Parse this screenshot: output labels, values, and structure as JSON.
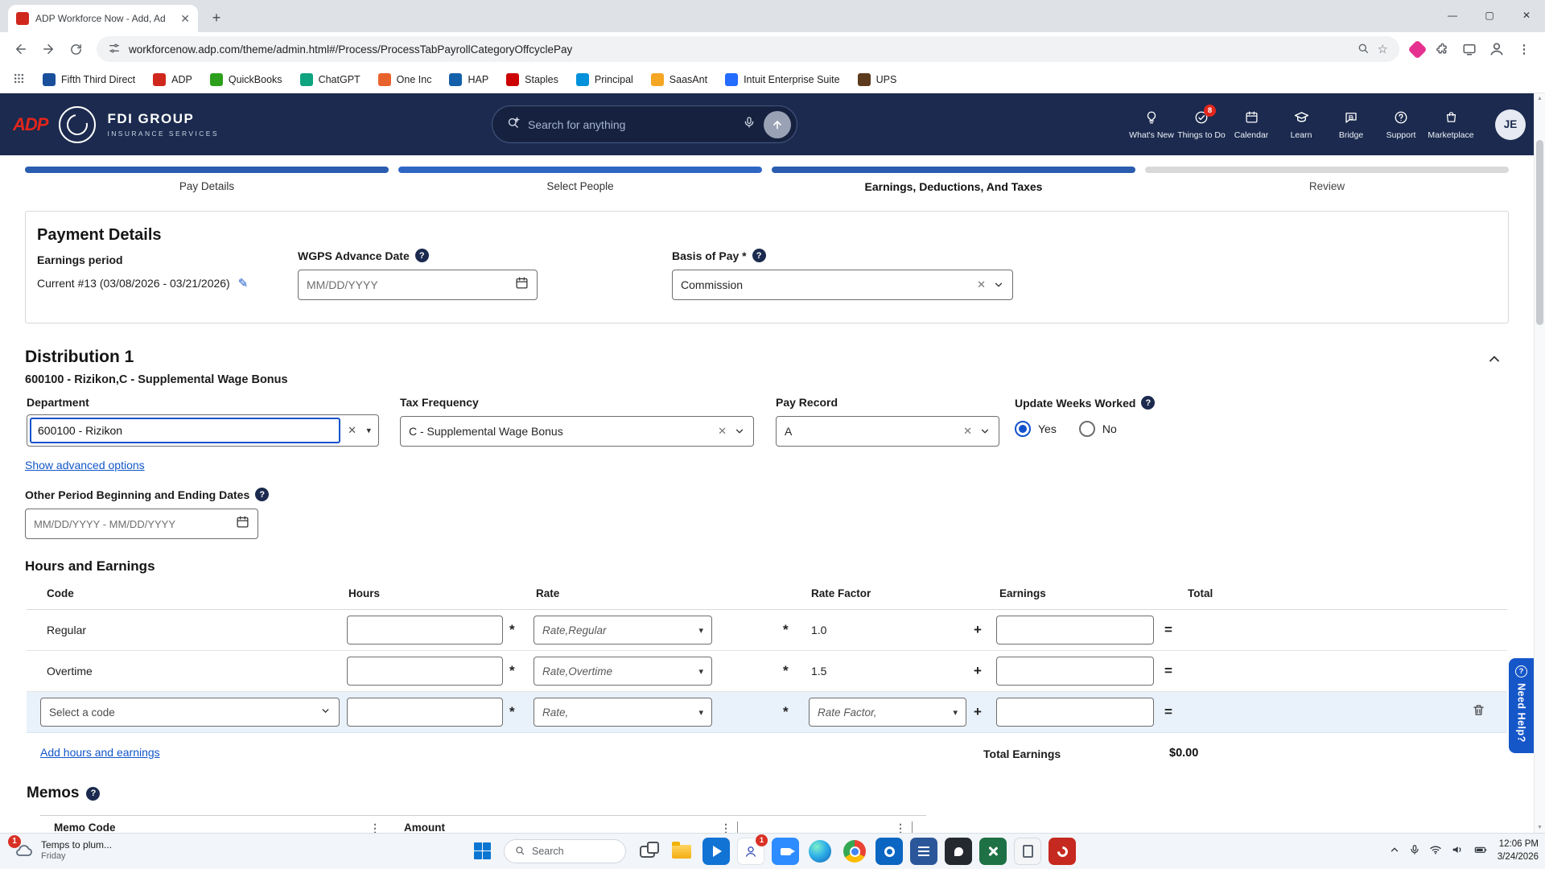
{
  "colors": {
    "accent_blue": "#1452cc",
    "header_navy": "#1b2a4e",
    "progress_blue": "#2a5cb0",
    "adp_red": "#e1261c",
    "highlight_row": "#e9f1fb",
    "link_blue": "#1256c8"
  },
  "browser": {
    "tab_title": "ADP Workforce Now - Add, Ad",
    "url": "workforcenow.adp.com/theme/admin.html#/Process/ProcessTabPayrollCategoryOffcyclePay",
    "bookmarks": [
      "Fifth Third Direct",
      "ADP",
      "QuickBooks",
      "ChatGPT",
      "One Inc",
      "HAP",
      "Staples",
      "Principal",
      "SaasAnt",
      "Intuit Enterprise Suite",
      "UPS"
    ]
  },
  "adp_header": {
    "logo_text": "ADP",
    "brand_line1": "FDI GROUP",
    "brand_line2": "INSURANCE SERVICES",
    "search_placeholder": "Search for anything",
    "nav": [
      "What's New",
      "Things to Do",
      "Calendar",
      "Learn",
      "Bridge",
      "Support",
      "Marketplace"
    ],
    "things_to_do_badge": "8",
    "avatar_initials": "JE"
  },
  "steps": {
    "labels": [
      "Pay Details",
      "Select People",
      "Earnings, Deductions, And Taxes",
      "Review"
    ]
  },
  "payment_details": {
    "title": "Payment Details",
    "earnings_period_label": "Earnings period",
    "earnings_period_value": "Current #13 (03/08/2026 - 03/21/2026)",
    "wgps_label": "WGPS Advance Date",
    "wgps_placeholder": "MM/DD/YYYY",
    "basis_label": "Basis of Pay *",
    "basis_value": "Commission"
  },
  "distribution": {
    "title": "Distribution 1",
    "subtitle": "600100 - Rizikon,C - Supplemental Wage Bonus",
    "department_label": "Department",
    "department_value": "600100 - Rizikon",
    "tax_frequency_label": "Tax Frequency",
    "tax_frequency_value": "C - Supplemental Wage Bonus",
    "pay_record_label": "Pay Record",
    "pay_record_value": "A",
    "update_weeks_label": "Update Weeks Worked",
    "yes_label": "Yes",
    "no_label": "No",
    "advanced_link": "Show advanced options",
    "other_period_label": "Other Period Beginning and Ending Dates",
    "other_period_placeholder": "MM/DD/YYYY - MM/DD/YYYY"
  },
  "hours_earnings": {
    "title": "Hours and Earnings",
    "headers": {
      "code": "Code",
      "hours": "Hours",
      "rate": "Rate",
      "rate_factor": "Rate Factor",
      "earnings": "Earnings",
      "total": "Total"
    },
    "operators": {
      "multiply": "*",
      "plus": "+",
      "equals": "="
    },
    "rows": [
      {
        "code": "Regular",
        "rate_placeholder": "Rate,Regular",
        "rate_factor": "1.0"
      },
      {
        "code": "Overtime",
        "rate_placeholder": "Rate,Overtime",
        "rate_factor": "1.5"
      },
      {
        "code_placeholder": "Select a code",
        "rate_placeholder": "Rate,",
        "rate_factor_placeholder": "Rate Factor,"
      }
    ],
    "add_link": "Add hours and earnings",
    "total_label": "Total Earnings",
    "total_value": "$0.00"
  },
  "memos": {
    "title": "Memos",
    "headers": [
      "Memo Code",
      "Amount"
    ]
  },
  "need_help_label": "Need Help?",
  "taskbar": {
    "widget_line1": "Temps to plum...",
    "widget_line2": "Friday",
    "widget_badge": "1",
    "app_badge": "1",
    "search_placeholder": "Search",
    "time": "12:06 PM",
    "date": "3/24/2026"
  }
}
